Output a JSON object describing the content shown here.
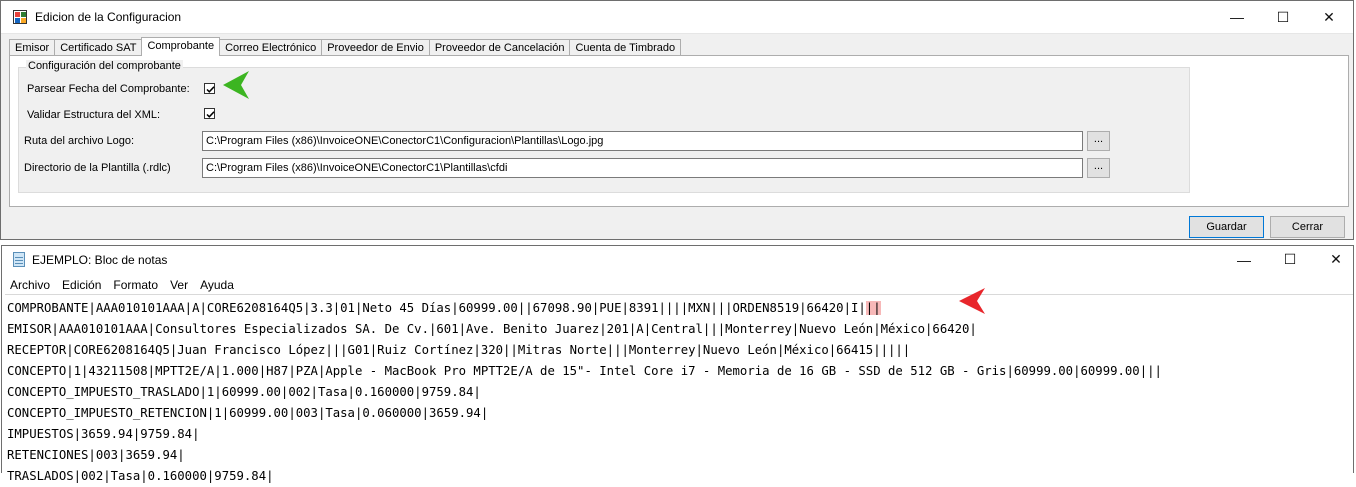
{
  "config_window": {
    "title": "Edicion de la Configuracion",
    "controls": {
      "minimize": "—",
      "maximize": "☐",
      "close": "✕"
    },
    "tabs": [
      {
        "label": "Emisor",
        "active": false
      },
      {
        "label": "Certificado SAT",
        "active": false
      },
      {
        "label": "Comprobante",
        "active": true
      },
      {
        "label": "Correo Electrónico",
        "active": false
      },
      {
        "label": "Proveedor de Envio",
        "active": false
      },
      {
        "label": "Proveedor de Cancelación",
        "active": false
      },
      {
        "label": "Cuenta de Timbrado",
        "active": false
      }
    ],
    "group_title": "Configuración del comprobante",
    "parse_date_label": "Parsear Fecha del Comprobante:",
    "parse_date_checked": true,
    "validate_xml_label": "Validar Estructura del XML:",
    "validate_xml_checked": true,
    "logo_label": "Ruta del archivo Logo:",
    "logo_value": "C:\\Program Files (x86)\\InvoiceONE\\ConectorC1\\Configuracion\\Plantillas\\Logo.jpg",
    "template_dir_label": "Directorio de la Plantilla (.rdlc)",
    "template_dir_value": "C:\\Program Files (x86)\\InvoiceONE\\ConectorC1\\Plantillas\\cfdi",
    "browse_label": "...",
    "save_label": "Guardar",
    "close_label": "Cerrar"
  },
  "notepad": {
    "title": "EJEMPLO: Bloc de notas",
    "controls": {
      "minimize": "—",
      "maximize": "☐",
      "close": "✕"
    },
    "menu": [
      "Archivo",
      "Edición",
      "Formato",
      "Ver",
      "Ayuda"
    ],
    "first_line_text": "COMPROBANTE|AAA010101AAA|A|CORE6208164Q5|3.3|01|Neto 45 Días|60999.00||67098.90|PUE|8391||||MXN|||ORDEN8519|66420|I|",
    "first_line_highlight": "||",
    "lines": [
      "EMISOR|AAA010101AAA|Consultores Especializados SA. De Cv.|601|Ave. Benito Juarez|201|A|Central|||Monterrey|Nuevo León|México|66420|",
      "RECEPTOR|CORE6208164Q5|Juan Francisco López|||G01|Ruiz Cortínez|320||Mitras Norte|||Monterrey|Nuevo León|México|66415|||||",
      "CONCEPTO|1|43211508|MPTT2E/A|1.000|H87|PZA|Apple - MacBook Pro MPTT2E/A de 15\"- Intel Core i7 - Memoria de 16 GB - SSD de 512 GB - Gris|60999.00|60999.00|||",
      "CONCEPTO_IMPUESTO_TRASLADO|1|60999.00|002|Tasa|0.160000|9759.84|",
      "CONCEPTO_IMPUESTO_RETENCION|1|60999.00|003|Tasa|0.060000|3659.94|",
      "IMPUESTOS|3659.94|9759.84|",
      "RETENCIONES|003|3659.94|",
      "TRASLADOS|002|Tasa|0.160000|9759.84|"
    ]
  },
  "annotation_colors": {
    "green_arrow": "#3cb521",
    "red_arrow": "#e8262b"
  }
}
